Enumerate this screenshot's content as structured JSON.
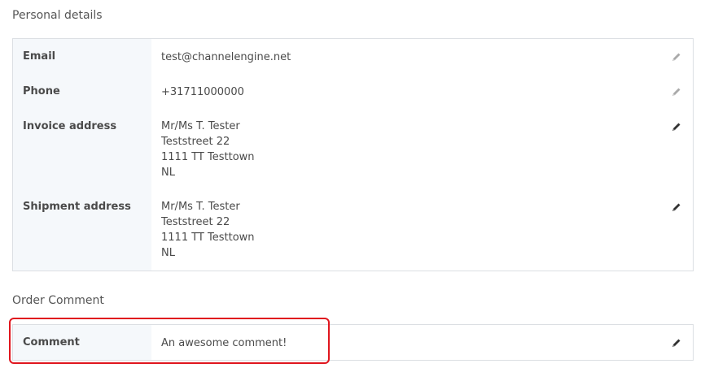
{
  "personal_details": {
    "title": "Personal details",
    "rows": [
      {
        "label": "Email",
        "value_lines": [
          "test@channelengine.net"
        ],
        "icon": "pencil-icon",
        "icon_color": "#aaaaaa"
      },
      {
        "label": "Phone",
        "value_lines": [
          "+31711000000"
        ],
        "icon": "pencil-icon",
        "icon_color": "#aaaaaa"
      },
      {
        "label": "Invoice address",
        "value_lines": [
          "Mr/Ms T. Tester",
          "Teststreet 22",
          "1111 TT Testtown",
          "NL"
        ],
        "icon": "pencil-icon",
        "icon_color": "#333333"
      },
      {
        "label": "Shipment address",
        "value_lines": [
          "Mr/Ms T. Tester",
          "Teststreet 22",
          "1111 TT Testtown",
          "NL"
        ],
        "icon": "pencil-icon",
        "icon_color": "#333333"
      }
    ]
  },
  "order_comment": {
    "title": "Order Comment",
    "rows": [
      {
        "label": "Comment",
        "value_lines": [
          "An awesome comment!"
        ],
        "icon": "pencil-icon",
        "icon_color": "#333333"
      }
    ]
  },
  "highlight_color": "#e0161e"
}
